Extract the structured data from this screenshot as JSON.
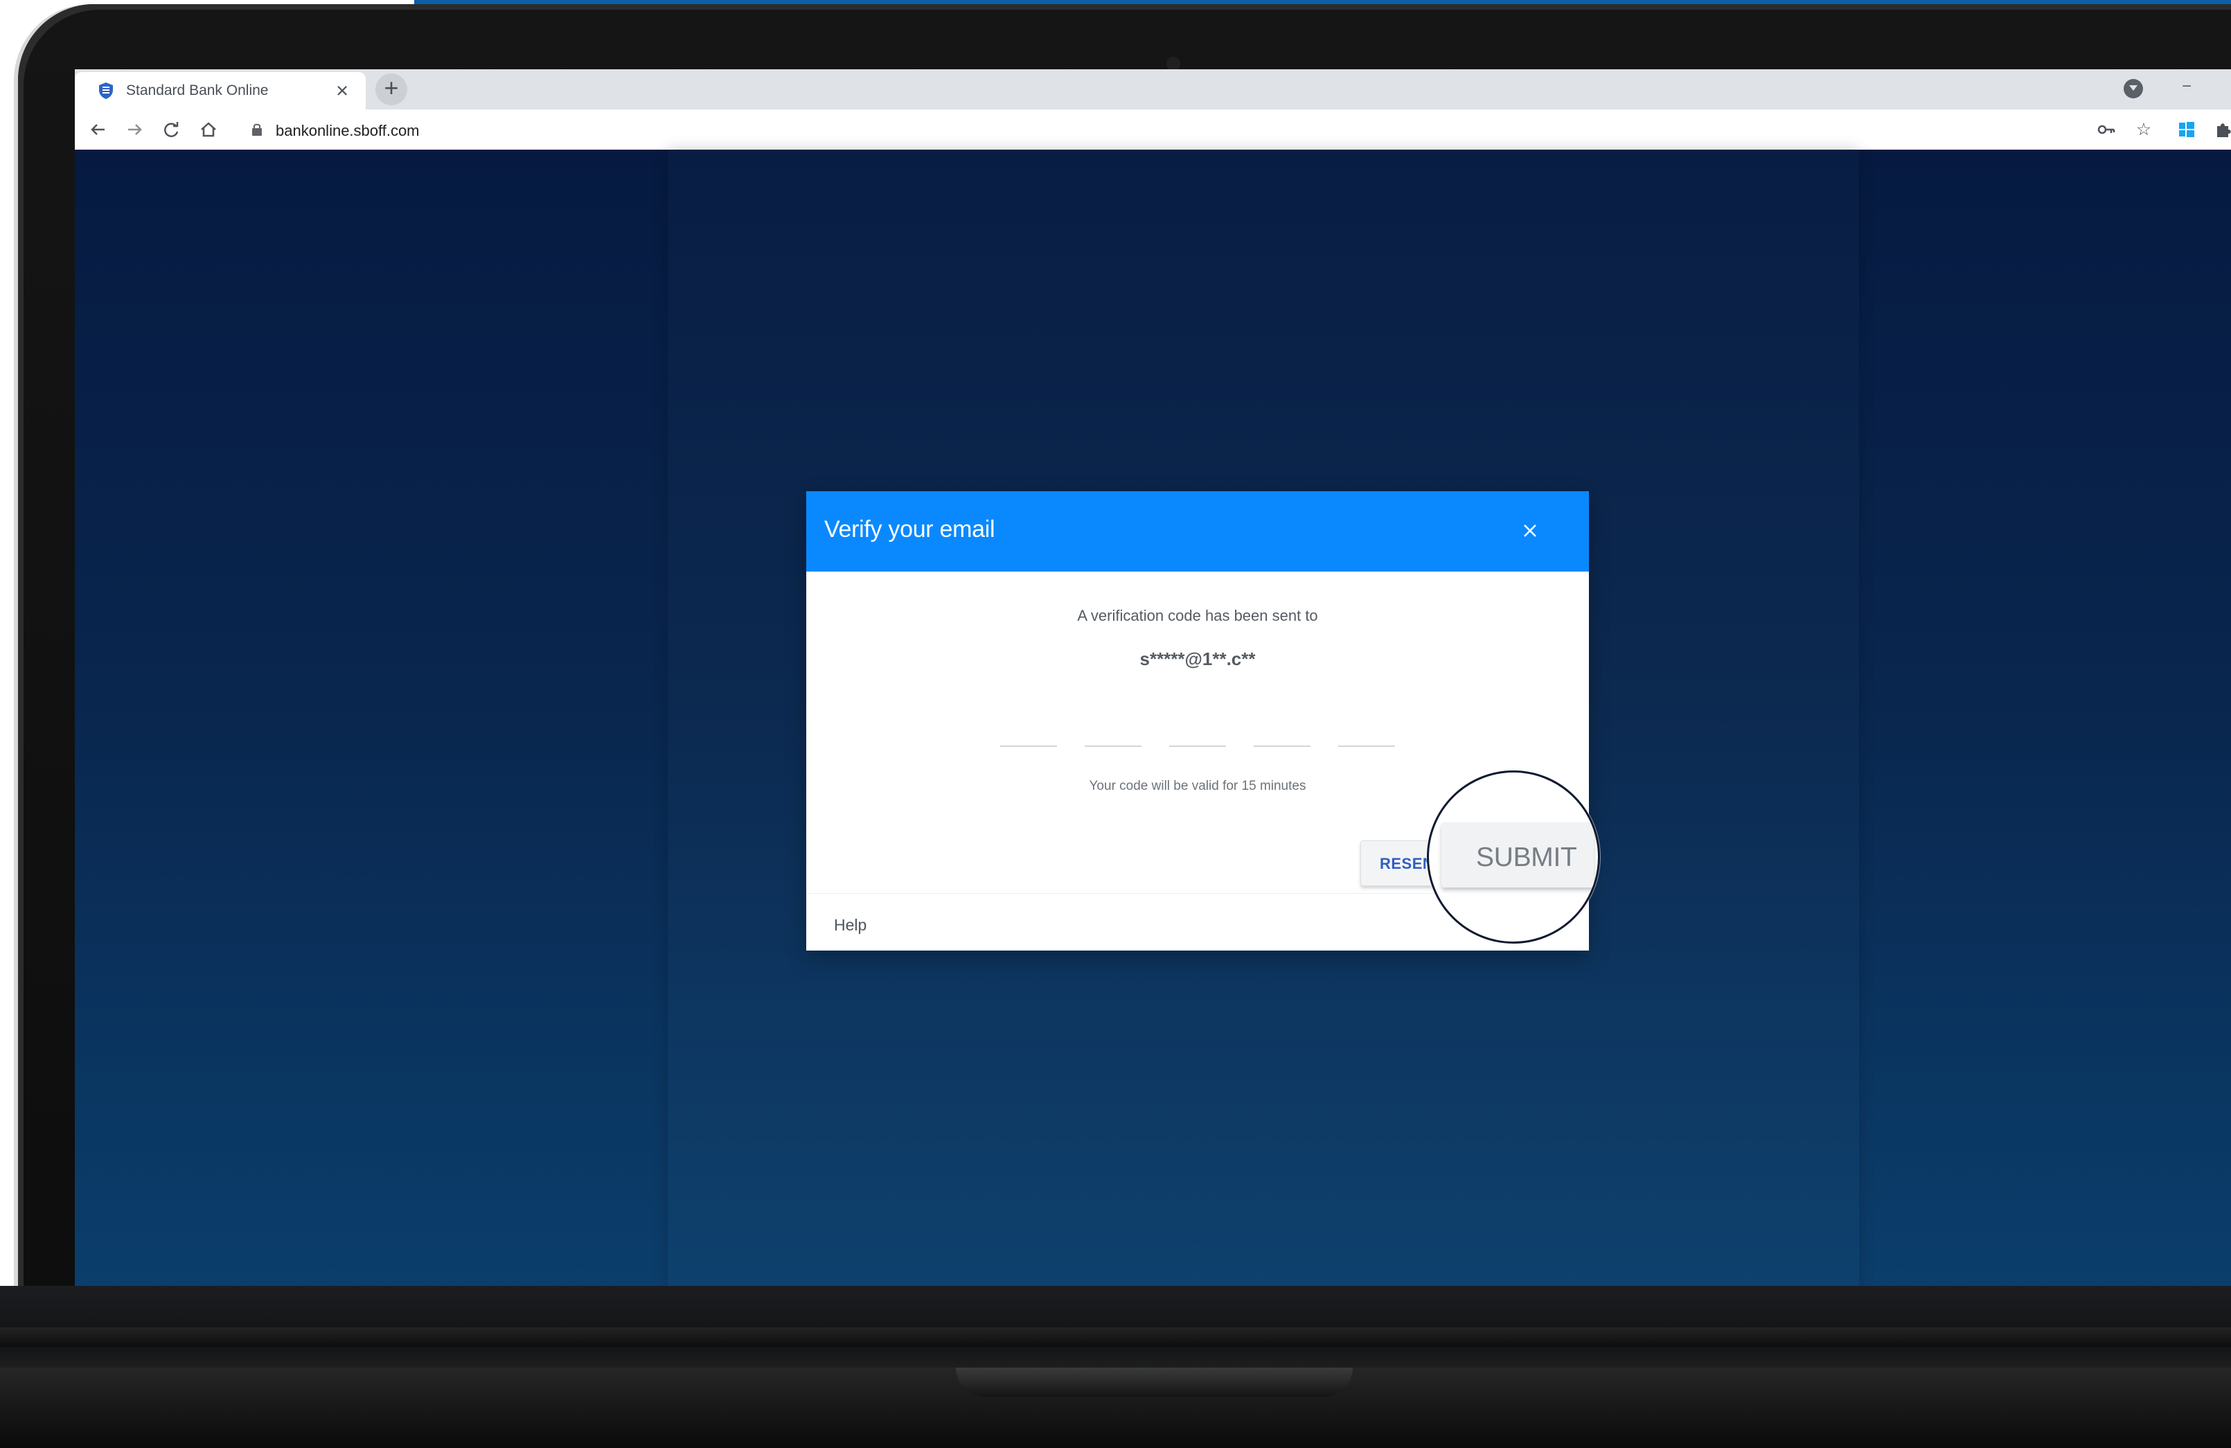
{
  "browser": {
    "tab_title": "Standard Bank Online",
    "close_tab_label": "×",
    "new_tab_label": "+",
    "url": "bankonline.sboff.com",
    "minimize_label": "−"
  },
  "dialog": {
    "title": "Verify your email",
    "sent_message": "A verification code has been sent to",
    "email": "s*****@1**.c**",
    "valid_note": "Your code will be valid for 15 minutes",
    "resend_button": "RESEN",
    "submit_button": "SUBMIT",
    "help_link": "Help"
  },
  "colors": {
    "dialog_header": "#0a89ff",
    "page_background": "#0b2d5b"
  },
  "icons": {
    "favicon": "bank-shield-icon",
    "close_tab": "close-icon",
    "back": "back-arrow-icon",
    "forward": "forward-arrow-icon",
    "reload": "reload-icon",
    "home": "home-icon",
    "lock": "lock-icon",
    "key": "key-icon",
    "bookmark": "star-icon",
    "windows": "windows-icon",
    "extensions": "puzzle-icon",
    "dialog_close": "close-icon"
  }
}
